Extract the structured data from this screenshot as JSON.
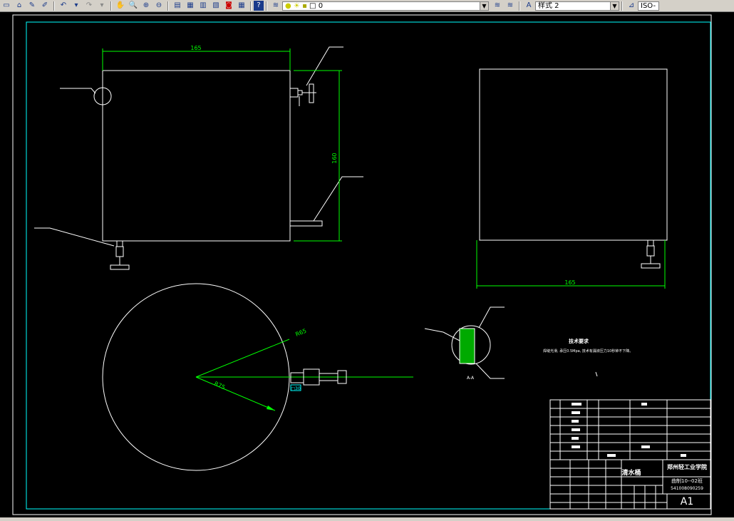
{
  "toolbar": {
    "layer_value": "0",
    "style_value": "样式 2",
    "dim_style_value": "ISO-"
  },
  "drawing": {
    "dim_width": "165",
    "dim_height": "160",
    "dim_side_width": "165",
    "dim_r1": "R65",
    "dim_r2": "R75",
    "dim_tab": "□30",
    "tech_title": "技术要求",
    "tech_text": "焊缝光滑, 承压0.5Mpa, 技术有漏液压力10秒钟不下降。",
    "section_label": "A-A",
    "title_block": {
      "part_name": "清水桶",
      "school": "郑州轻工业学院",
      "drawing_no": "曲制10--02班",
      "student_no": "541008090259",
      "sheet_size": "A1"
    }
  },
  "colors": {
    "background": "#000000",
    "line_white": "#ffffff",
    "line_green": "#00ff00",
    "frame_cyan": "#00ffff",
    "toolbar_gray": "#d4d0c8"
  }
}
